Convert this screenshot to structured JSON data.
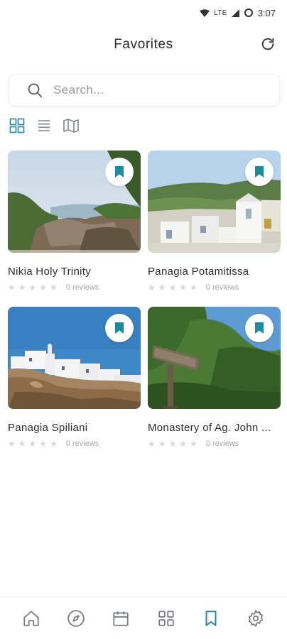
{
  "status_bar": {
    "network": "LTE",
    "time": "3:07"
  },
  "header": {
    "title": "Favorites"
  },
  "search": {
    "placeholder": "Search..."
  },
  "favorites": [
    {
      "name": "Nikia Holy Trinity",
      "reviews": "0 reviews",
      "rating": 0
    },
    {
      "name": "Panagia Potamitissa",
      "reviews": "0 reviews",
      "rating": 0
    },
    {
      "name": "Panagia Spiliani",
      "reviews": "0 reviews",
      "rating": 0
    },
    {
      "name": "Monastery of Ag. John ...",
      "reviews": "0 reviews",
      "rating": 0
    }
  ],
  "colors": {
    "accent": "#1f8a9e",
    "icon_gray": "#6f7a86",
    "star_empty": "#d8d8d8"
  },
  "icons": {
    "nav": [
      "home-icon",
      "compass-icon",
      "calendar-icon",
      "grid-icon",
      "bookmark-icon",
      "settings-icon"
    ],
    "active_nav": "bookmark-icon"
  }
}
